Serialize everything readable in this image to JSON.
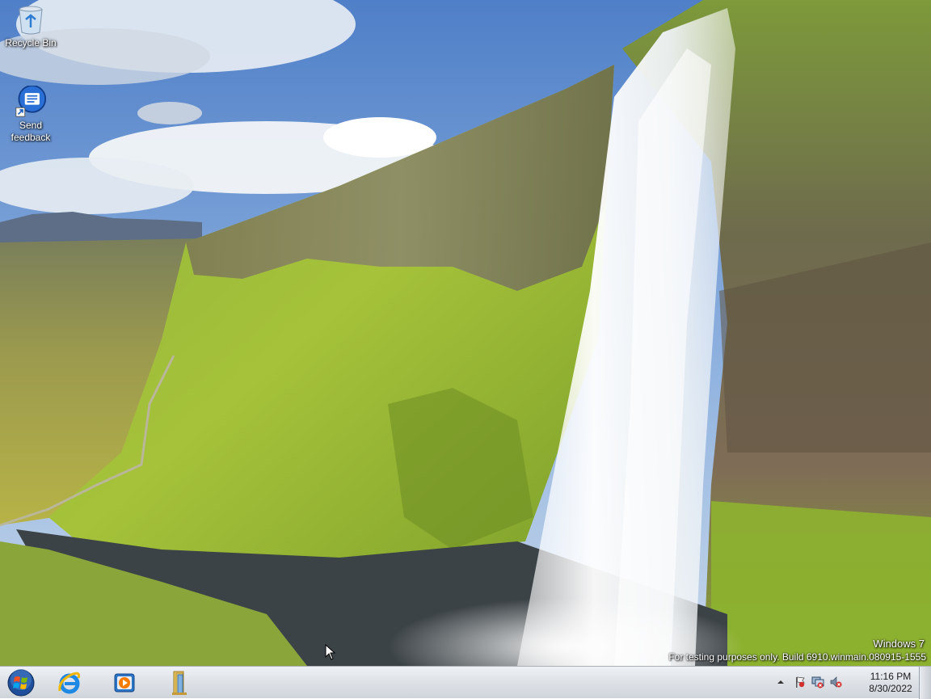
{
  "desktop": {
    "icons": [
      {
        "label": "Recycle Bin",
        "icon": "recycle-bin-icon"
      },
      {
        "label": "Send feedback",
        "icon": "send-feedback-icon"
      }
    ],
    "watermark": {
      "line1": "Windows 7",
      "line2": "For testing purposes only. Build 6910.winmain.080915-1555"
    }
  },
  "taskbar": {
    "pinned": [
      {
        "name": "start-button",
        "icon": "windows-orb-icon"
      },
      {
        "name": "internet-explorer",
        "icon": "internet-explorer-icon"
      },
      {
        "name": "media-player",
        "icon": "media-player-icon"
      },
      {
        "name": "file-explorer",
        "icon": "folder-libraries-icon"
      }
    ],
    "tray": {
      "time": "11:16 PM",
      "date": "8/30/2022",
      "icons": [
        "show-hidden-icons-chevron",
        "action-center-flag-icon",
        "network-disconnected-icon",
        "volume-muted-icon"
      ]
    }
  },
  "colors": {
    "taskbar": "#dfe3e8",
    "label_text": "#ffffff"
  }
}
